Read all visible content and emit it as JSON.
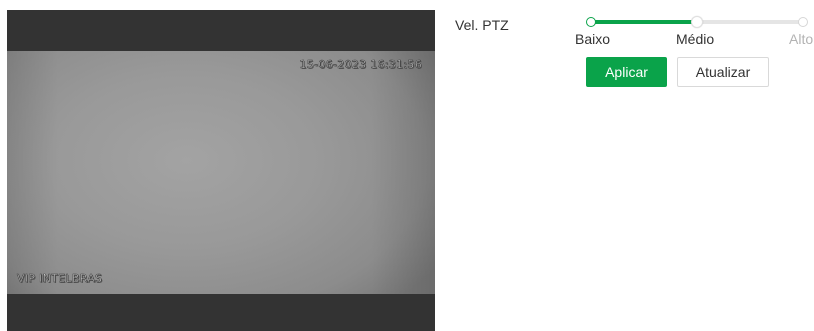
{
  "video": {
    "datetime_overlay": "15-06-2023 16:31:56",
    "channel_overlay": "VIP INTELBRAS"
  },
  "ptz_speed": {
    "label": "Vel. PTZ",
    "levels": [
      "Baixo",
      "Médio",
      "Alto"
    ],
    "selected": "Médio",
    "value_fraction": 0.5
  },
  "buttons": {
    "apply_label": "Aplicar",
    "refresh_label": "Atualizar"
  },
  "colors": {
    "accent": "#0aa34a",
    "video_letterbox": "#333333",
    "disabled_text": "#b3b3b3"
  }
}
